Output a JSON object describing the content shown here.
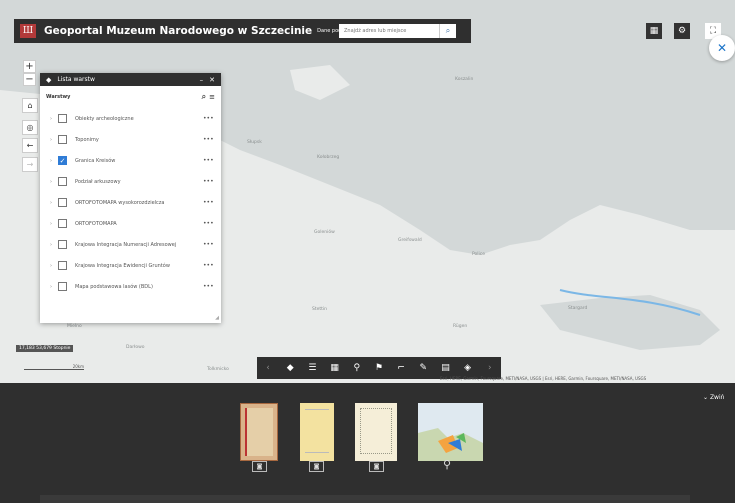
{
  "header": {
    "title": "Geoportal Muzeum Narodowego w Szczecinie",
    "subtitle": "Dane podstawowe",
    "search_placeholder": "Znajdź adres lub miejsce"
  },
  "map": {
    "labels": [
      "Koszalin",
      "Koszalin",
      "Słupsk",
      "Ustka",
      "Kołobrzeg",
      "Gdańsk",
      "Stettin",
      "Police",
      "Goleniów",
      "Wolgast",
      "Rügen",
      "Greifswald",
      "Mielno",
      "Darłowo",
      "Tolkmicko",
      "Stargard"
    ],
    "scale_text": "17,183 53,679 Stopnie",
    "scale_bar": "20km",
    "attribution": "Esri, HERE, Garmin, Foursquare, METI/NASA, USGS | Esri, HERE, Garmin, Foursquare, METI/NASA, USGS"
  },
  "layers_panel": {
    "title": "Lista warstw",
    "section_label": "Warstwy",
    "items": [
      {
        "label": "Obiekty archeologiczne",
        "checked": false
      },
      {
        "label": "Toponimy",
        "checked": false
      },
      {
        "label": "Granica Kreisów",
        "checked": true
      },
      {
        "label": "Podział arkuszowy",
        "checked": false
      },
      {
        "label": "ORTOFOTOMAPA wysokorozdzielcza",
        "checked": false
      },
      {
        "label": "ORTOFOTOMAPA",
        "checked": false
      },
      {
        "label": "Krajowa Integracja Numeracji Adresowej",
        "checked": false
      },
      {
        "label": "Krajowa Integracja Ewidencji Gruntów",
        "checked": false
      },
      {
        "label": "Mapa podstawowa lasów (BDL)",
        "checked": false
      }
    ]
  },
  "bottom": {
    "collapse_label": "Zwiń"
  },
  "colors": {
    "dark": "#2f2f2f",
    "accent": "#2f7cd6",
    "map_bg": "#e9ebea",
    "water": "#d3d8d8"
  }
}
